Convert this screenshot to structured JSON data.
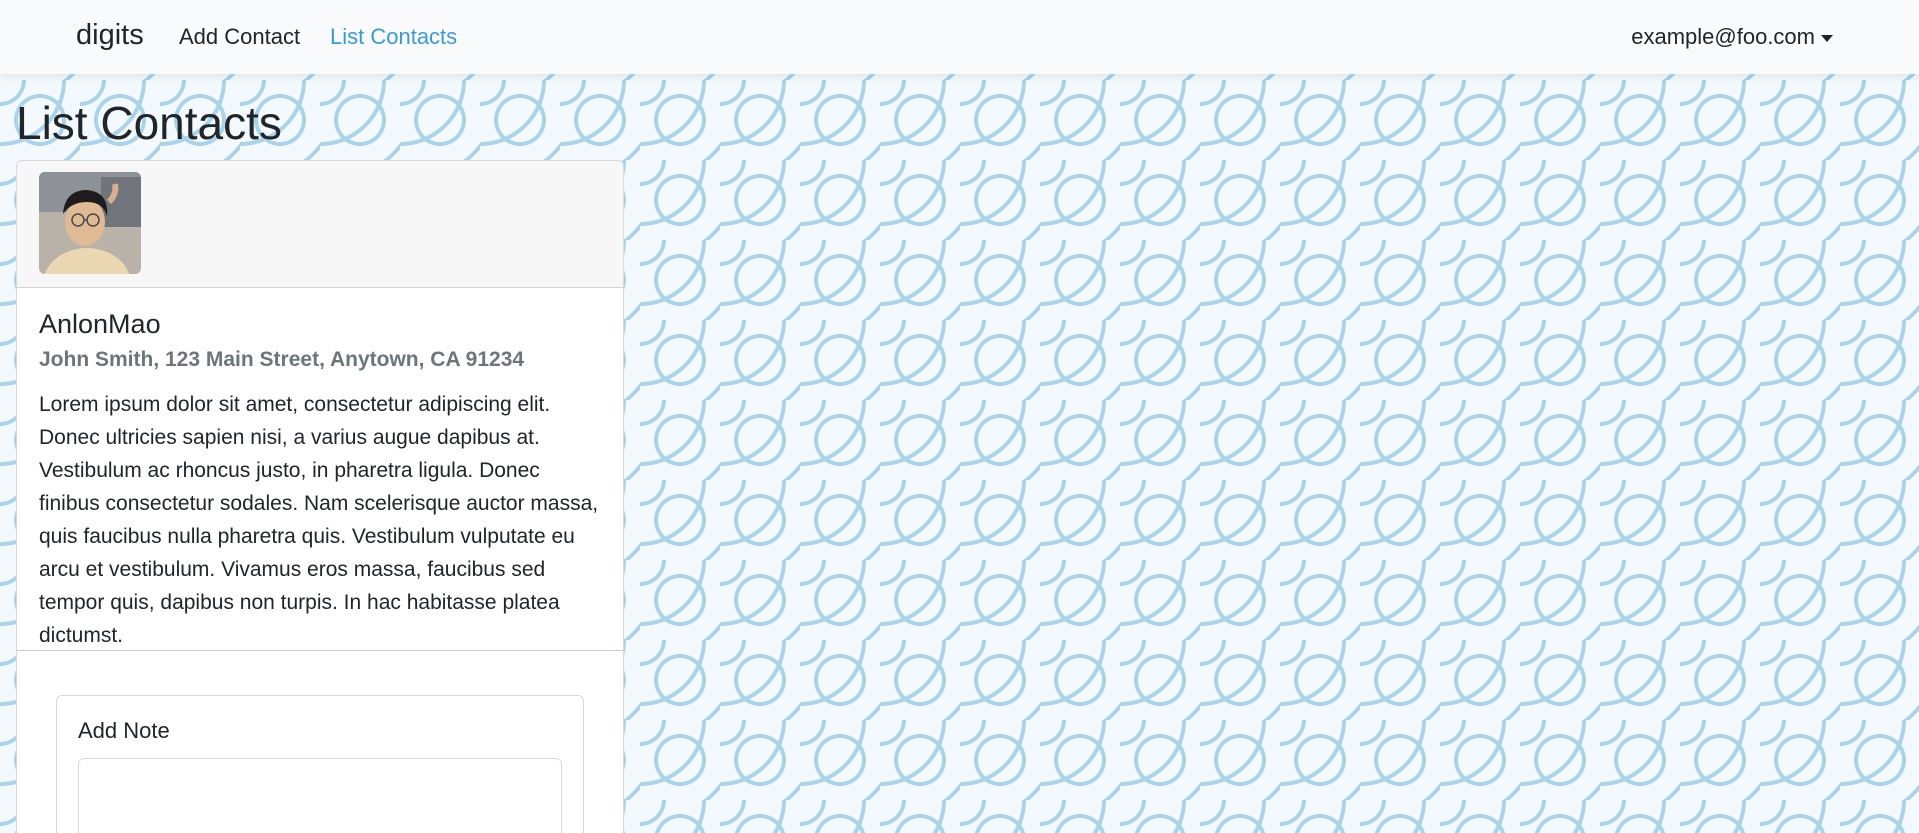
{
  "navbar": {
    "brand": "digits",
    "links": [
      {
        "label": "Add Contact",
        "active": false
      },
      {
        "label": "List Contacts",
        "active": true
      }
    ],
    "user_email": "example@foo.com"
  },
  "page": {
    "title": "List Contacts"
  },
  "contact": {
    "name": "AnlonMao",
    "address": "John Smith, 123 Main Street, Anytown, CA 91234",
    "description": "Lorem ipsum dolor sit amet, consectetur adipiscing elit. Donec ultricies sapien nisi, a varius augue dapibus at. Vestibulum ac rhoncus justo, in pharetra ligula. Donec finibus consectetur sodales. Nam scelerisque auctor massa, quis faucibus nulla pharetra quis. Vestibulum vulputate eu arcu et vestibulum. Vivamus eros massa, faucibus sed tempor quis, dapibus non turpis. In hac habitasse platea dictumst.",
    "avatar_icon": "profile-photo"
  },
  "note": {
    "label": "Add Note",
    "value": ""
  },
  "colors": {
    "accent": "#3a9bd8",
    "pattern": "#a9d4ea",
    "muted_text": "#6c757d"
  }
}
